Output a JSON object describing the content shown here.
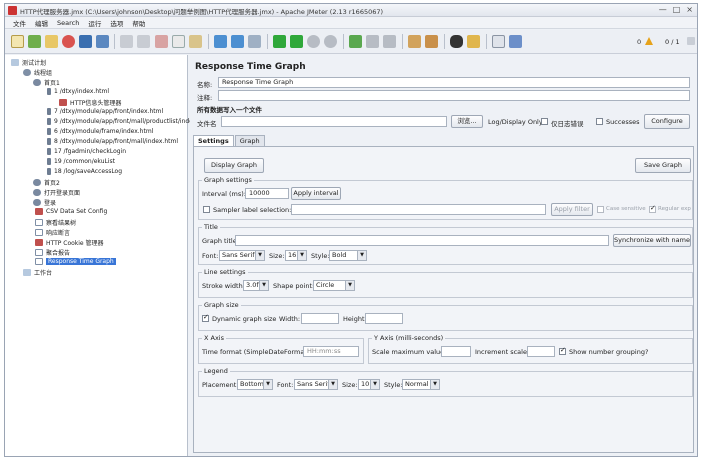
{
  "window": {
    "title": "HTTP代理服务器.jmx (C:\\Users\\johnson\\Desktop\\问题举例图\\HTTP代理服务器.jmx) - Apache JMeter (2.13 r1665067)",
    "min": "—",
    "max": "□",
    "close": "×"
  },
  "menu": [
    "文件",
    "编辑",
    "Search",
    "运行",
    "选项",
    "帮助"
  ],
  "toolbar": {
    "warn_count": "0",
    "thread_ratio": "0 / 1"
  },
  "tree": [
    {
      "label": "测试计划",
      "level": 0
    },
    {
      "label": "线程组",
      "level": 1
    },
    {
      "label": "首页1",
      "level": 2
    },
    {
      "label": "1 /dtxy/index.html",
      "level": 3
    },
    {
      "label": "HTTP信息头管理器",
      "level": 4
    },
    {
      "label": "7 /dtxy/module/app/front/index.html",
      "level": 3
    },
    {
      "label": "9 /dtxy/module/app/front/mall/productlist/index.h",
      "level": 3
    },
    {
      "label": "6 /dtxy/module/frame/index.html",
      "level": 3
    },
    {
      "label": "8 /dtxy/module/app/front/mall/index.html",
      "level": 3
    },
    {
      "label": "17 /fgadmin/checkLogin",
      "level": 3
    },
    {
      "label": "19 /common/ekuList",
      "level": 3
    },
    {
      "label": "18 /log/saveAccessLog",
      "level": 3
    },
    {
      "label": "首页2",
      "level": 2
    },
    {
      "label": "打开登录页面",
      "level": 2
    },
    {
      "label": "登录",
      "level": 2
    },
    {
      "label": "CSV Data Set Config",
      "level": 2
    },
    {
      "label": "察看结果树",
      "level": 2
    },
    {
      "label": "响应断言",
      "level": 2
    },
    {
      "label": "HTTP Cookie 管理器",
      "level": 2
    },
    {
      "label": "聚合报告",
      "level": 2
    },
    {
      "label": "Response Time Graph",
      "level": 2
    },
    {
      "label": "工作台",
      "level": 0
    }
  ],
  "panel": {
    "title": "Response Time Graph",
    "name_label": "名称:",
    "name_value": "Response Time Graph",
    "comment_label": "注释:",
    "write_all_label": "所有数据写入一个文件",
    "filename_label": "文件名",
    "browse": "浏览...",
    "log_display_only": "Log/Display Only:",
    "errors_only": "仅日志错误",
    "successes": "Successes",
    "configure": "Configure"
  },
  "tabs": [
    "Settings",
    "Graph"
  ],
  "settings": {
    "display_graph": "Display Graph",
    "save_graph": "Save Graph",
    "graph_settings_title": "Graph settings",
    "interval_label": "Interval (ms):",
    "interval_value": "10000",
    "apply_interval": "Apply interval",
    "sampler_label_selection": "Sampler label selection:",
    "apply_filter": "Apply filter",
    "case_sensitive": "Case sensitive",
    "regular_exp": "Regular exp",
    "title_group": "Title",
    "graph_title_label": "Graph title:",
    "synchronize": "Synchronize with name",
    "font_label": "Font:",
    "font_value": "Sans Serif",
    "size_label": "Size:",
    "size_value": "16",
    "style_label": "Style:",
    "style_value": "Bold",
    "line_settings_title": "Line settings",
    "stroke_width_label": "Stroke width:",
    "stroke_width_value": "3.0f",
    "shape_point_label": "Shape point:",
    "shape_point_value": "Circle",
    "graph_size_title": "Graph size",
    "dynamic_graph_size": "Dynamic graph size",
    "width_label": "Width:",
    "height_label": "Height:",
    "x_axis_title": "X Axis",
    "time_format_label": "Time format (SimpleDateFormat):",
    "time_format_placeholder": "HH:mm:ss",
    "y_axis_title": "Y Axis (milli-seconds)",
    "scale_max_label": "Scale maximum value:",
    "increment_scale_label": "Increment scale:",
    "show_number_grouping": "Show number grouping?",
    "legend_title": "Legend",
    "placement_label": "Placement:",
    "placement_value": "Bottom",
    "legend_font_label": "Font:",
    "legend_font_value": "Sans Serif",
    "legend_size_label": "Size:",
    "legend_size_value": "10",
    "legend_style_label": "Style:",
    "legend_style_value": "Normal"
  }
}
